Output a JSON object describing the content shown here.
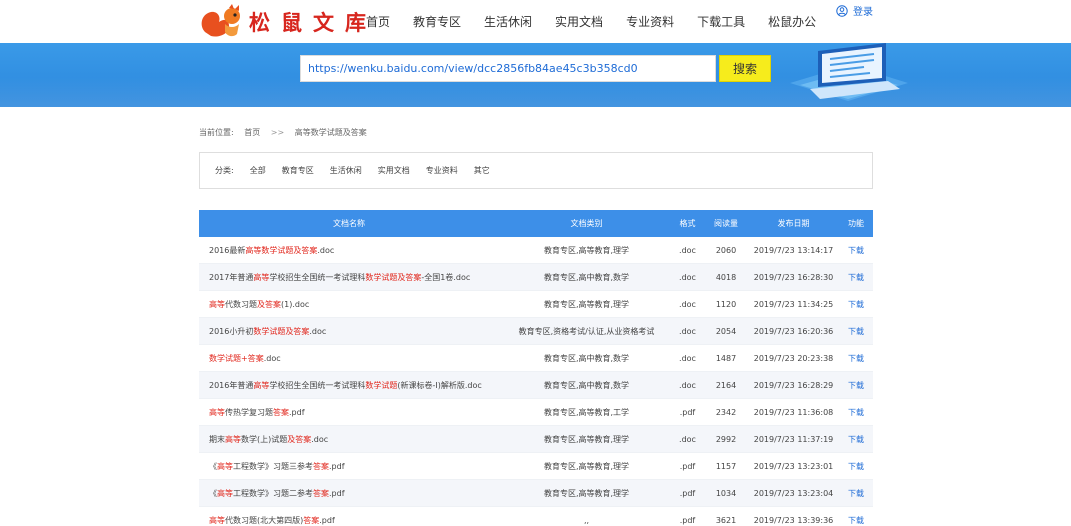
{
  "brand": {
    "name": "松鼠文库"
  },
  "nav": {
    "items": [
      "首页",
      "教育专区",
      "生活休闲",
      "实用文档",
      "专业资料",
      "下载工具",
      "松鼠办公"
    ]
  },
  "login": {
    "label": "登录"
  },
  "search": {
    "value": "https://wenku.baidu.com/view/dcc2856fb84ae45c3b358cd0",
    "button": "搜索"
  },
  "breadcrumb": {
    "label": "当前位置:",
    "home": "首页",
    "sep": ">>",
    "current": "高等数学试题及答案"
  },
  "category": {
    "label": "分类:",
    "items": [
      "全部",
      "教育专区",
      "生活休闲",
      "实用文档",
      "专业资料",
      "其它"
    ]
  },
  "table": {
    "headers": [
      "文档名称",
      "文档类别",
      "格式",
      "阅读量",
      "发布日期",
      "功能"
    ],
    "rows": [
      {
        "name_parts": [
          {
            "t": "2016最新",
            "h": false
          },
          {
            "t": "高等数学试题及答案",
            "h": true
          },
          {
            "t": ".doc",
            "h": false
          }
        ],
        "category": "教育专区,高等教育,理学",
        "format": ".doc",
        "reads": "2060",
        "date": "2019/7/23 13:14:17",
        "action": "下载"
      },
      {
        "name_parts": [
          {
            "t": "2017年普通",
            "h": false
          },
          {
            "t": "高等",
            "h": true
          },
          {
            "t": "学校招生全国统一考试理科",
            "h": false
          },
          {
            "t": "数学试题及答案",
            "h": true
          },
          {
            "t": "-全国1卷.doc",
            "h": false
          }
        ],
        "category": "教育专区,高中教育,数学",
        "format": ".doc",
        "reads": "4018",
        "date": "2019/7/23 16:28:30",
        "action": "下载"
      },
      {
        "name_parts": [
          {
            "t": "高等",
            "h": true
          },
          {
            "t": "代数习题",
            "h": false
          },
          {
            "t": "及答案",
            "h": true
          },
          {
            "t": "(1).doc",
            "h": false
          }
        ],
        "category": "教育专区,高等教育,理学",
        "format": ".doc",
        "reads": "1120",
        "date": "2019/7/23 11:34:25",
        "action": "下载"
      },
      {
        "name_parts": [
          {
            "t": "2016小升初",
            "h": false
          },
          {
            "t": "数学试题及答案",
            "h": true
          },
          {
            "t": ".doc",
            "h": false
          }
        ],
        "category": "教育专区,资格考试/认证,从业资格考试",
        "format": ".doc",
        "reads": "2054",
        "date": "2019/7/23 16:20:36",
        "action": "下载"
      },
      {
        "name_parts": [
          {
            "t": "数学试题+答案",
            "h": true
          },
          {
            "t": ".doc",
            "h": false
          }
        ],
        "category": "教育专区,高中教育,数学",
        "format": ".doc",
        "reads": "1487",
        "date": "2019/7/23 20:23:38",
        "action": "下载"
      },
      {
        "name_parts": [
          {
            "t": "2016年普通",
            "h": false
          },
          {
            "t": "高等",
            "h": true
          },
          {
            "t": "学校招生全国统一考试理科",
            "h": false
          },
          {
            "t": "数学试题",
            "h": true
          },
          {
            "t": "(新课标卷-I)解析版.doc",
            "h": false
          }
        ],
        "category": "教育专区,高中教育,数学",
        "format": ".doc",
        "reads": "2164",
        "date": "2019/7/23 16:28:29",
        "action": "下载"
      },
      {
        "name_parts": [
          {
            "t": "高等",
            "h": true
          },
          {
            "t": "传热学复习题",
            "h": false
          },
          {
            "t": "答案",
            "h": true
          },
          {
            "t": ".pdf",
            "h": false
          }
        ],
        "category": "教育专区,高等教育,工学",
        "format": ".pdf",
        "reads": "2342",
        "date": "2019/7/23 11:36:08",
        "action": "下载"
      },
      {
        "name_parts": [
          {
            "t": "期末",
            "h": false
          },
          {
            "t": "高等",
            "h": true
          },
          {
            "t": "数学(上)试题",
            "h": false
          },
          {
            "t": "及答案",
            "h": true
          },
          {
            "t": ".doc",
            "h": false
          }
        ],
        "category": "教育专区,高等教育,理学",
        "format": ".doc",
        "reads": "2992",
        "date": "2019/7/23 11:37:19",
        "action": "下载"
      },
      {
        "name_parts": [
          {
            "t": "《",
            "h": false
          },
          {
            "t": "高等",
            "h": true
          },
          {
            "t": "工程数学》习题三参考",
            "h": false
          },
          {
            "t": "答案",
            "h": true
          },
          {
            "t": ".pdf",
            "h": false
          }
        ],
        "category": "教育专区,高等教育,理学",
        "format": ".pdf",
        "reads": "1157",
        "date": "2019/7/23 13:23:01",
        "action": "下载"
      },
      {
        "name_parts": [
          {
            "t": "《",
            "h": false
          },
          {
            "t": "高等",
            "h": true
          },
          {
            "t": "工程数学》习题二参考",
            "h": false
          },
          {
            "t": "答案",
            "h": true
          },
          {
            "t": ".pdf",
            "h": false
          }
        ],
        "category": "教育专区,高等教育,理学",
        "format": ".pdf",
        "reads": "1034",
        "date": "2019/7/23 13:23:04",
        "action": "下载"
      },
      {
        "name_parts": [
          {
            "t": "高等",
            "h": true
          },
          {
            "t": "代数习题(北大第四版)",
            "h": false
          },
          {
            "t": "答案",
            "h": true
          },
          {
            "t": ".pdf",
            "h": false
          }
        ],
        "category": ",,",
        "format": ".pdf",
        "reads": "3621",
        "date": "2019/7/23 13:39:36",
        "action": "下载"
      }
    ]
  },
  "colors": {
    "accent": "#3d8fe8",
    "highlight": "#e1251b",
    "search_button": "#f6ec1c",
    "link": "#1e6bd6"
  }
}
